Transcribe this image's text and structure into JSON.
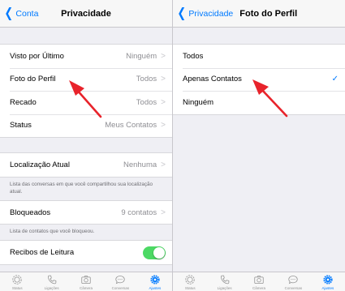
{
  "colors": {
    "accent": "#007aff",
    "arrow": "#e8232b",
    "toggle_on": "#4cd964"
  },
  "left": {
    "back_label": "Conta",
    "title": "Privacidade",
    "rows_main": [
      {
        "label": "Visto por Último",
        "value": "Ninguém"
      },
      {
        "label": "Foto do Perfil",
        "value": "Todos"
      },
      {
        "label": "Recado",
        "value": "Todos"
      },
      {
        "label": "Status",
        "value": "Meus Contatos"
      }
    ],
    "location": {
      "label": "Localização Atual",
      "value": "Nenhuma"
    },
    "location_note": "Lista das conversas em que você compartilhou sua localização atual.",
    "blocked": {
      "label": "Bloqueados",
      "value": "9 contatos"
    },
    "blocked_note": "Lista de contatos que você bloqueou.",
    "read_receipts": {
      "label": "Recibos de Leitura",
      "enabled": true
    }
  },
  "right": {
    "back_label": "Privacidade",
    "title": "Foto do Perfil",
    "options": [
      {
        "label": "Todos",
        "selected": false
      },
      {
        "label": "Apenas Contatos",
        "selected": true
      },
      {
        "label": "Ninguém",
        "selected": false
      }
    ]
  },
  "tabbar": {
    "tabs": [
      {
        "label": "Status",
        "icon": "status-icon"
      },
      {
        "label": "Ligações",
        "icon": "phone-icon"
      },
      {
        "label": "Câmera",
        "icon": "camera-icon"
      },
      {
        "label": "Conversas",
        "icon": "chat-icon"
      },
      {
        "label": "Ajustes",
        "icon": "settings-gear-icon",
        "active": true
      }
    ]
  }
}
